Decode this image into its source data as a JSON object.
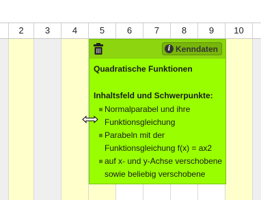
{
  "columns": [
    "2",
    "3",
    "4",
    "5",
    "6",
    "7",
    "8",
    "9",
    "10"
  ],
  "card": {
    "title": "Quadratische Funktionen",
    "section_heading": "Inhaltsfeld und Schwerpunkte:",
    "items": [
      "Normalparabel und ihre Funktionsgleichung",
      "Parabeln mit der Funktionsgleichung f(x) = ax2",
      "auf x- und y-Achse verschobene sowie beliebig verschobene Normalparabel"
    ],
    "kenndaten_label": "Kenndaten",
    "delete_icon": "trash-icon",
    "info_icon": "info-icon"
  },
  "colors": {
    "card_bg": "#99ff00",
    "card_header": "#8cd50f",
    "yellow_column": "#ffffcc",
    "gray_column": "#efefef"
  }
}
